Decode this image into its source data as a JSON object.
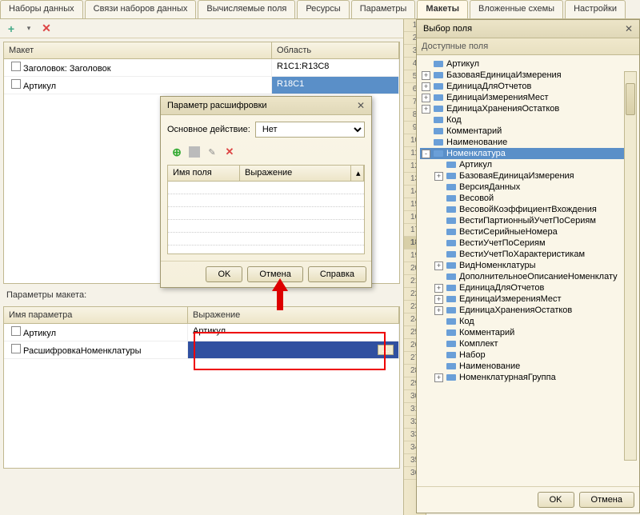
{
  "tabs": {
    "items": [
      "Наборы данных",
      "Связи наборов данных",
      "Вычисляемые поля",
      "Ресурсы",
      "Параметры",
      "Макеты",
      "Вложенные схемы",
      "Настройки"
    ],
    "active": 5
  },
  "layouts": {
    "header_layout": "Макет",
    "header_area": "Область",
    "rows": [
      {
        "name": "Заголовок: Заголовок",
        "area": "R1C1:R13C8"
      },
      {
        "name": "Артикул",
        "area": "R18C1"
      }
    ]
  },
  "params": {
    "title": "Параметры макета:",
    "header_name": "Имя параметра",
    "header_expr": "Выражение",
    "rows": [
      {
        "name": "Артикул",
        "expr": "Артикул"
      },
      {
        "name": "РасшифровкаНоменклатуры",
        "expr": ""
      }
    ]
  },
  "drill_dialog": {
    "title": "Параметр расшифровки",
    "action_label": "Основное действие:",
    "action_value": "Нет",
    "col_field": "Имя поля",
    "col_expr": "Выражение",
    "ok": "OK",
    "cancel": "Отмена",
    "help": "Справка"
  },
  "field_chooser": {
    "title": "Выбор поля",
    "section": "Доступные поля",
    "ok": "OK",
    "cancel": "Отмена",
    "fields_top": [
      "Артикул",
      "БазоваяЕдиницаИзмерения",
      "ЕдиницаДляОтчетов",
      "ЕдиницаИзмеренияМест",
      "ЕдиницаХраненияОстатков",
      "Код",
      "Комментарий",
      "Наименование"
    ],
    "selected": "Номенклатура",
    "fields_nested": [
      "Артикул",
      "БазоваяЕдиницаИзмерения",
      "ВерсияДанных",
      "Весовой",
      "ВесовойКоэффициентВхождения",
      "ВестиПартионныйУчетПоСериям",
      "ВестиСерийныеНомера",
      "ВестиУчетПоСериям",
      "ВестиУчетПоХарактеристикам",
      "ВидНоменклатуры",
      "ДополнительноеОписаниеНоменклату",
      "ЕдиницаДляОтчетов",
      "ЕдиницаИзмеренияМест",
      "ЕдиницаХраненияОстатков",
      "Код",
      "Комментарий",
      "Комплект",
      "Набор",
      "Наименование",
      "НоменклатурнаяГруппа"
    ]
  },
  "ruler": {
    "from": 1,
    "to": 36,
    "current": 18
  }
}
